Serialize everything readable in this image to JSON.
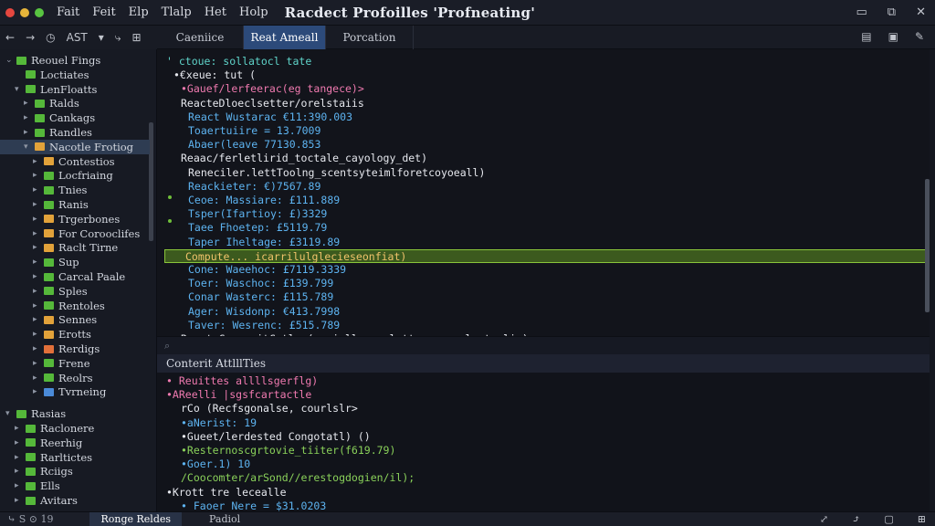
{
  "titlebar": {
    "menu": [
      "Fait",
      "Feit",
      "Elp",
      "Tlalp",
      "Het",
      "Holp"
    ],
    "title": "Racdect Profoilles 'Profneating'",
    "controls": [
      "▭",
      "⧉",
      "✕"
    ]
  },
  "toolbar": {
    "items": [
      "←",
      "→",
      "◷",
      "AST",
      "▾",
      "⤷",
      "⊞"
    ]
  },
  "tabs": [
    {
      "label": "Caeniice",
      "active": false
    },
    {
      "label": "Reat Ameall",
      "active": true
    },
    {
      "label": "Porcation",
      "active": false
    }
  ],
  "tab_actions": [
    "▤",
    "▣",
    "✎"
  ],
  "sidebar": {
    "items": [
      {
        "label": "Reouel Fings",
        "depth": 0,
        "twisty": "⌄",
        "color": "#55b83a"
      },
      {
        "label": "Loctiates",
        "depth": 1,
        "twisty": "",
        "color": "#55b83a"
      },
      {
        "label": "LenFloatts",
        "depth": 1,
        "twisty": "▾",
        "color": "#55b83a"
      },
      {
        "label": "Ralds",
        "depth": 2,
        "twisty": "▸",
        "color": "#55b83a"
      },
      {
        "label": "Cankags",
        "depth": 2,
        "twisty": "▸",
        "color": "#55b83a"
      },
      {
        "label": "Randles",
        "depth": 2,
        "twisty": "▸",
        "color": "#55b83a"
      },
      {
        "label": "Nacotle Frotiog",
        "depth": 2,
        "twisty": "▾",
        "color": "#e2a23a",
        "selected": true
      },
      {
        "label": "Contestios",
        "depth": 3,
        "twisty": "▸",
        "color": "#e2a23a"
      },
      {
        "label": "Locfriaing",
        "depth": 3,
        "twisty": "▸",
        "color": "#55b83a"
      },
      {
        "label": "Tnies",
        "depth": 3,
        "twisty": "▸",
        "color": "#55b83a"
      },
      {
        "label": "Ranis",
        "depth": 3,
        "twisty": "▸",
        "color": "#55b83a"
      },
      {
        "label": "Trgerbones",
        "depth": 3,
        "twisty": "▸",
        "color": "#e2a23a"
      },
      {
        "label": "For Corooclifes",
        "depth": 3,
        "twisty": "▸",
        "color": "#e2a23a"
      },
      {
        "label": "Raclt Tirne",
        "depth": 3,
        "twisty": "▸",
        "color": "#e2a23a"
      },
      {
        "label": "Sup",
        "depth": 3,
        "twisty": "▸",
        "color": "#55b83a"
      },
      {
        "label": "Carcal Paale",
        "depth": 3,
        "twisty": "▸",
        "color": "#55b83a"
      },
      {
        "label": "Sples",
        "depth": 3,
        "twisty": "▸",
        "color": "#55b83a"
      },
      {
        "label": "Rentoles",
        "depth": 3,
        "twisty": "▸",
        "color": "#55b83a"
      },
      {
        "label": "Sennes",
        "depth": 3,
        "twisty": "▸",
        "color": "#e2a23a"
      },
      {
        "label": "Erotts",
        "depth": 3,
        "twisty": "▸",
        "color": "#e2a23a"
      },
      {
        "label": "Rerdigs",
        "depth": 3,
        "twisty": "▸",
        "color": "#e2703a"
      },
      {
        "label": "Frene",
        "depth": 3,
        "twisty": "▸",
        "color": "#55b83a"
      },
      {
        "label": "Reolrs",
        "depth": 3,
        "twisty": "▸",
        "color": "#55b83a"
      },
      {
        "label": "Tvrneing",
        "depth": 3,
        "twisty": "▸",
        "color": "#4a8ad8"
      },
      {
        "label": "Rasias",
        "depth": 0,
        "twisty": "▾",
        "color": "#55b83a"
      },
      {
        "label": "Raclonere",
        "depth": 1,
        "twisty": "▸",
        "color": "#55b83a"
      },
      {
        "label": "Reerhig",
        "depth": 1,
        "twisty": "▸",
        "color": "#55b83a"
      },
      {
        "label": "Rarltictes",
        "depth": 1,
        "twisty": "▸",
        "color": "#55b83a"
      },
      {
        "label": "Rciigs",
        "depth": 1,
        "twisty": "▸",
        "color": "#55b83a"
      },
      {
        "label": "Ells",
        "depth": 1,
        "twisty": "▸",
        "color": "#55b83a"
      },
      {
        "label": "Avitars",
        "depth": 1,
        "twisty": "▸",
        "color": "#55b83a"
      }
    ]
  },
  "editor": {
    "lines": [
      {
        "indent": 0,
        "text": "' ctoue: sollatocl tate",
        "cls": "cy"
      },
      {
        "indent": 1,
        "text": "•€xeue: tut (",
        "cls": "fn"
      },
      {
        "indent": 2,
        "text": "•Gauef/lerfeerac(eg tangece)>",
        "cls": "pink"
      },
      {
        "indent": 2,
        "text": "ReacteDloeclsetter/orelstaiis",
        "cls": "fn"
      },
      {
        "indent": 3,
        "text": "React Wustarac €11:390.003",
        "cls": "num"
      },
      {
        "indent": 3,
        "text": "Toaertuiire = 13.7009",
        "cls": "num"
      },
      {
        "indent": 3,
        "text": "Abaer(leave 77130.853",
        "cls": "num"
      },
      {
        "indent": 2,
        "text": "Reaac/ferletlirid_toctale_cayology_det)",
        "cls": "fn"
      },
      {
        "indent": 3,
        "text": "Reneciler.lettToolng_scentsyteimlforetcoyoeall)",
        "cls": "fn"
      },
      {
        "indent": 3,
        "text": "Reackieter: €)7567.89",
        "cls": "num"
      },
      {
        "indent": 3,
        "text": "Ceoe: Massiare: £111.889",
        "cls": "num"
      },
      {
        "indent": 3,
        "text": "Tsper(Ifartioy: £)3329",
        "cls": "num"
      },
      {
        "indent": 3,
        "text": "Taee Fhoetep: £5119.79",
        "cls": "num"
      },
      {
        "indent": 3,
        "text": "Taper Iheltage: £3119.89",
        "cls": "num"
      },
      {
        "indent": 1,
        "text": "Compute... icarrilulglecieseonfiat)",
        "cls": "str",
        "highlight": true
      },
      {
        "indent": 3,
        "text": "Cone: Waeehoc: £7119.3339",
        "cls": "num"
      },
      {
        "indent": 3,
        "text": "Toer: Waschoc: £139.799",
        "cls": "num"
      },
      {
        "indent": 3,
        "text": "Conar Wasterc: £115.789",
        "cls": "num"
      },
      {
        "indent": 3,
        "text": "Ager: Wisdonp: €413.7998",
        "cls": "num"
      },
      {
        "indent": 3,
        "text": "Taver: Wesrenc: £515.789",
        "cls": "num"
      },
      {
        "indent": 2,
        "text": "React CeppocitCatl: (serially.conletts.ceny_clecterlis)",
        "cls": "fn"
      }
    ]
  },
  "splitbar": {
    "icon": "⌕"
  },
  "panel": {
    "title": "Conterit AttlllTies",
    "lines": [
      {
        "indent": 0,
        "text": "• Reuittes allllsgerflg)",
        "cls": "pink"
      },
      {
        "indent": 0,
        "text": "•AReelli |sgsfcartactle",
        "cls": "pink"
      },
      {
        "indent": 1,
        "text": "rCo (Recfsgonalse, courlslr>",
        "cls": "fn"
      },
      {
        "indent": 1,
        "text": "•aNerist: 19",
        "cls": "num"
      },
      {
        "indent": 1,
        "text": "•Gueet/lerdested Congotatl) ()",
        "cls": "fn"
      },
      {
        "indent": 1,
        "text": "•Resternoscgrtovie_tiiter(f619.79)",
        "cls": "grn"
      },
      {
        "indent": 1,
        "text": "•Goer.1) 10",
        "cls": "num"
      },
      {
        "indent": 1,
        "text": "/Coocomter/arSond//erestogdogien/il);",
        "cls": "grn"
      },
      {
        "indent": 0,
        "text": "•Krott tre lecealle",
        "cls": "fn"
      },
      {
        "indent": 1,
        "text": "• Faoer Nere = $31.0203",
        "cls": "num"
      }
    ]
  },
  "statusbar": {
    "left": "⤷ S  ⊙ 19",
    "tab": "Ronge Reldes",
    "tab2": "Padiol",
    "right": [
      "⤢",
      "⤴",
      "▢",
      "⊞"
    ]
  }
}
